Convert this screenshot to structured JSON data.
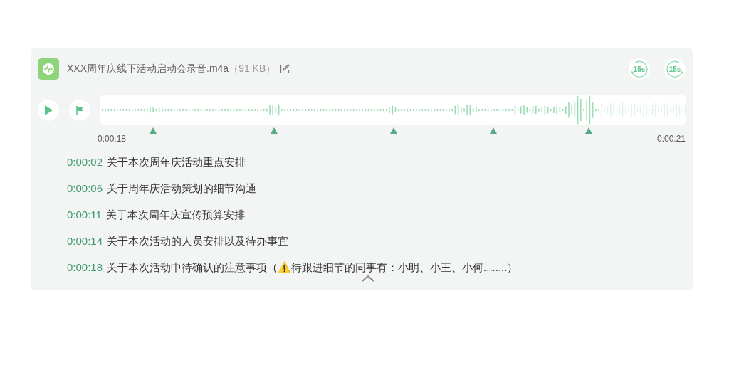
{
  "file": {
    "name": "XXX周年庆线下活动启动会录音.m4a",
    "size": "（91 KB）"
  },
  "skip_buttons": [
    {
      "label": "15s",
      "kind": "back"
    },
    {
      "label": "15s",
      "kind": "forward"
    }
  ],
  "player": {
    "playing": false,
    "level": 0.85,
    "start_time": "0:00:18",
    "end_time": "0:00:21",
    "markers": [
      {
        "level": 0.09
      },
      {
        "level": 0.297
      },
      {
        "level": 0.501
      },
      {
        "level": 0.672
      },
      {
        "level": 0.835
      }
    ]
  },
  "segments": [
    {
      "time": "0:00:02",
      "text": "关于本次周年庆活动重点安排"
    },
    {
      "time": "0:00:06",
      "text": "关于周年庆活动策划的细节沟通"
    },
    {
      "time": "0:00:11",
      "text": "关于本次周年庆宣传预算安排"
    },
    {
      "time": "0:00:14",
      "text": "关于本次活动的人员安排以及待办事宜"
    },
    {
      "time": "0:00:18",
      "text": "关于本次活动中待确认的注意事项（⚠️待跟进细节的同事有：小明、小王、小何........）"
    }
  ],
  "expanded": true
}
